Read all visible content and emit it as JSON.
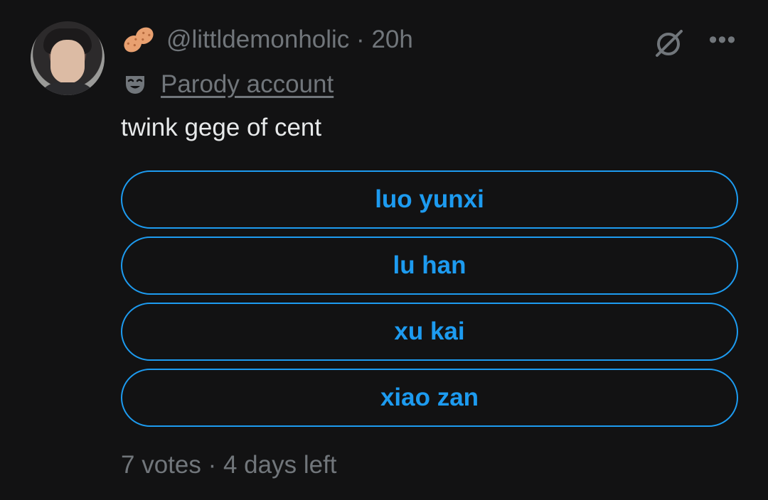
{
  "post": {
    "handle": "@littldemonholic",
    "separator": "·",
    "time": "20h",
    "parody_label": "Parody account",
    "text": "twink gege of cent",
    "icons": {
      "name_emoji": "peanut-icon",
      "parody": "mask-icon",
      "grok": "grok-icon",
      "more": "more-icon"
    }
  },
  "poll": {
    "options": [
      "luo yunxi",
      "lu han",
      "xu kai",
      "xiao zan"
    ],
    "votes_text": "7 votes",
    "separator": "·",
    "time_left": "4 days left"
  },
  "colors": {
    "background": "#121213",
    "accent": "#1d9bf0",
    "secondary_text": "#71767b",
    "primary_text": "#e7e9ea"
  }
}
